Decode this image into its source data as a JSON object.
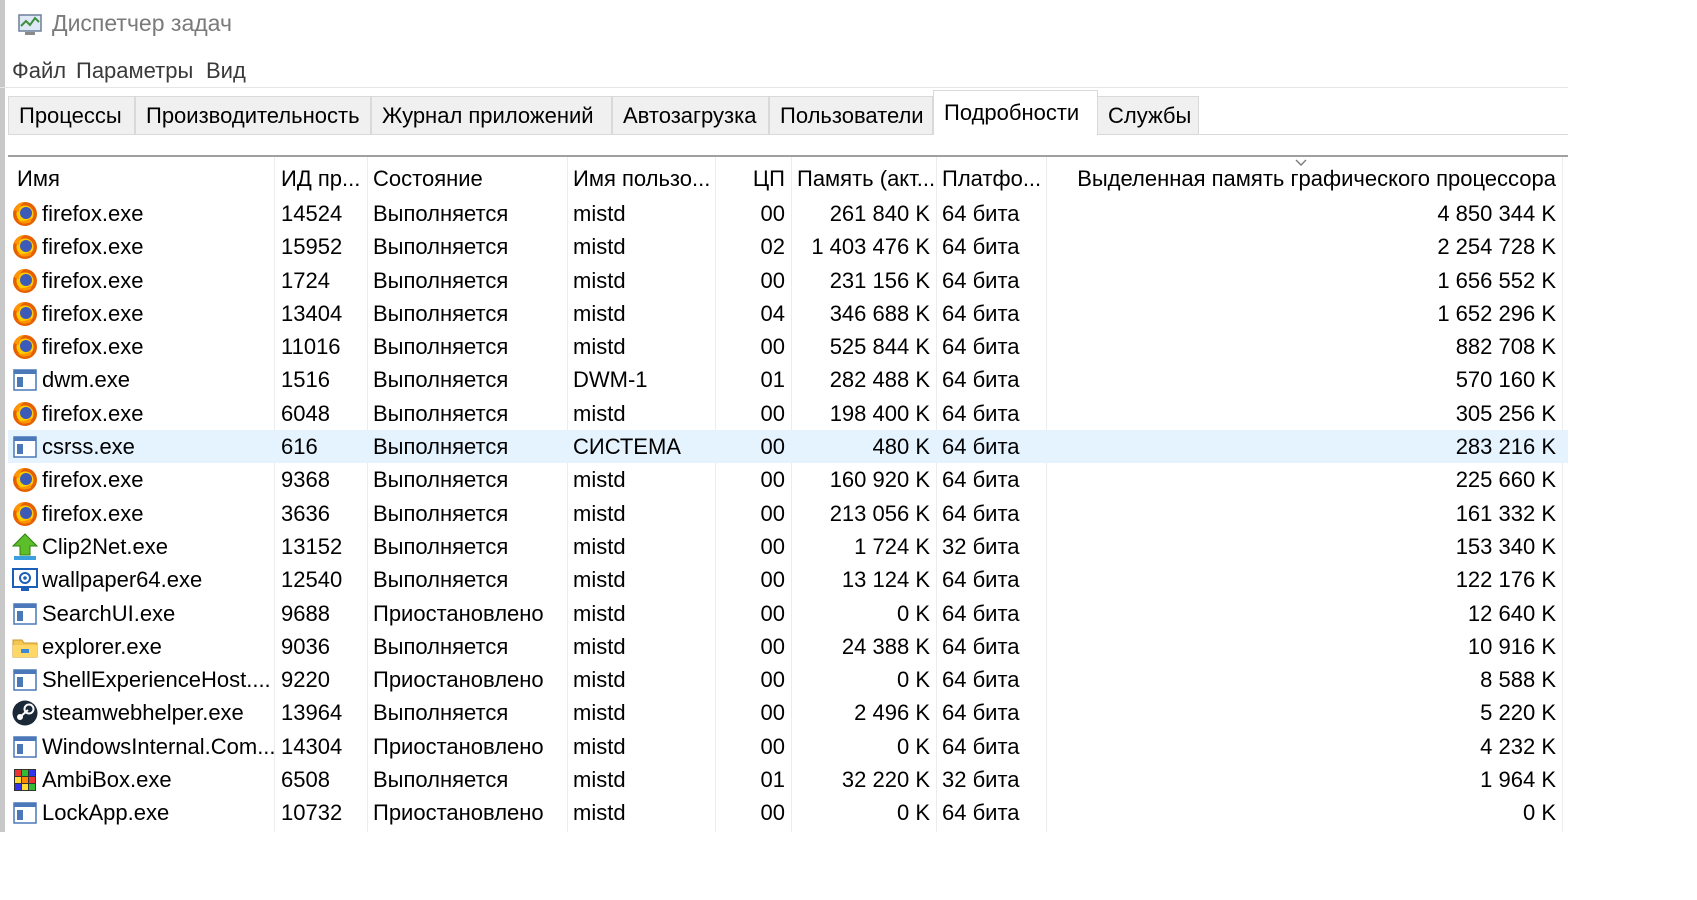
{
  "window": {
    "title": "Диспетчер задач"
  },
  "menu": [
    "Файл",
    "Параметры",
    "Вид"
  ],
  "tabs": [
    {
      "label": "Процессы",
      "active": false
    },
    {
      "label": "Производительность",
      "active": false
    },
    {
      "label": "Журнал приложений",
      "active": false
    },
    {
      "label": "Автозагрузка",
      "active": false
    },
    {
      "label": "Пользователи",
      "active": false
    },
    {
      "label": "Подробности",
      "active": true
    },
    {
      "label": "Службы",
      "active": false
    }
  ],
  "columns": [
    "Имя",
    "ИД пр...",
    "Состояние",
    "Имя пользо...",
    "ЦП",
    "Память (акт...",
    "Платфо...",
    "Выделенная память графического процессора"
  ],
  "rows": [
    {
      "icon": "firefox-icon",
      "name": "firefox.exe",
      "pid": "14524",
      "status": "Выполняется",
      "user": "mistd",
      "cpu": "00",
      "mem": "261 840 K",
      "platform": "64 бита",
      "gpu_mem": "4 850 344 K"
    },
    {
      "icon": "firefox-icon",
      "name": "firefox.exe",
      "pid": "15952",
      "status": "Выполняется",
      "user": "mistd",
      "cpu": "02",
      "mem": "1 403 476 K",
      "platform": "64 бита",
      "gpu_mem": "2 254 728 K"
    },
    {
      "icon": "firefox-icon",
      "name": "firefox.exe",
      "pid": "1724",
      "status": "Выполняется",
      "user": "mistd",
      "cpu": "00",
      "mem": "231 156 K",
      "platform": "64 бита",
      "gpu_mem": "1 656 552 K"
    },
    {
      "icon": "firefox-icon",
      "name": "firefox.exe",
      "pid": "13404",
      "status": "Выполняется",
      "user": "mistd",
      "cpu": "04",
      "mem": "346 688 K",
      "platform": "64 бита",
      "gpu_mem": "1 652 296 K"
    },
    {
      "icon": "firefox-icon",
      "name": "firefox.exe",
      "pid": "11016",
      "status": "Выполняется",
      "user": "mistd",
      "cpu": "00",
      "mem": "525 844 K",
      "platform": "64 бита",
      "gpu_mem": "882 708 K"
    },
    {
      "icon": "window-icon",
      "name": "dwm.exe",
      "pid": "1516",
      "status": "Выполняется",
      "user": "DWM-1",
      "cpu": "01",
      "mem": "282 488 K",
      "platform": "64 бита",
      "gpu_mem": "570 160 K"
    },
    {
      "icon": "firefox-icon",
      "name": "firefox.exe",
      "pid": "6048",
      "status": "Выполняется",
      "user": "mistd",
      "cpu": "00",
      "mem": "198 400 K",
      "platform": "64 бита",
      "gpu_mem": "305 256 K"
    },
    {
      "icon": "window-icon",
      "name": "csrss.exe",
      "pid": "616",
      "status": "Выполняется",
      "user": "СИСТЕМА",
      "cpu": "00",
      "mem": "480 K",
      "platform": "64 бита",
      "gpu_mem": "283 216 K",
      "selected": true
    },
    {
      "icon": "firefox-icon",
      "name": "firefox.exe",
      "pid": "9368",
      "status": "Выполняется",
      "user": "mistd",
      "cpu": "00",
      "mem": "160 920 K",
      "platform": "64 бита",
      "gpu_mem": "225 660 K"
    },
    {
      "icon": "firefox-icon",
      "name": "firefox.exe",
      "pid": "3636",
      "status": "Выполняется",
      "user": "mistd",
      "cpu": "00",
      "mem": "213 056 K",
      "platform": "64 бита",
      "gpu_mem": "161 332 K"
    },
    {
      "icon": "clip2net-icon",
      "name": "Clip2Net.exe",
      "pid": "13152",
      "status": "Выполняется",
      "user": "mistd",
      "cpu": "00",
      "mem": "1 724 K",
      "platform": "32 бита",
      "gpu_mem": "153 340 K"
    },
    {
      "icon": "wallpaper-icon",
      "name": "wallpaper64.exe",
      "pid": "12540",
      "status": "Выполняется",
      "user": "mistd",
      "cpu": "00",
      "mem": "13 124 K",
      "platform": "64 бита",
      "gpu_mem": "122 176 K"
    },
    {
      "icon": "window-icon",
      "name": "SearchUI.exe",
      "pid": "9688",
      "status": "Приостановлено",
      "user": "mistd",
      "cpu": "00",
      "mem": "0 K",
      "platform": "64 бита",
      "gpu_mem": "12 640 K"
    },
    {
      "icon": "folder-icon",
      "name": "explorer.exe",
      "pid": "9036",
      "status": "Выполняется",
      "user": "mistd",
      "cpu": "00",
      "mem": "24 388 K",
      "platform": "64 бита",
      "gpu_mem": "10 916 K"
    },
    {
      "icon": "window-icon",
      "name": "ShellExperienceHost....",
      "pid": "9220",
      "status": "Приостановлено",
      "user": "mistd",
      "cpu": "00",
      "mem": "0 K",
      "platform": "64 бита",
      "gpu_mem": "8 588 K"
    },
    {
      "icon": "steam-icon",
      "name": "steamwebhelper.exe",
      "pid": "13964",
      "status": "Выполняется",
      "user": "mistd",
      "cpu": "00",
      "mem": "2 496 K",
      "platform": "64 бита",
      "gpu_mem": "5 220 K"
    },
    {
      "icon": "window-icon",
      "name": "WindowsInternal.Com...",
      "pid": "14304",
      "status": "Приостановлено",
      "user": "mistd",
      "cpu": "00",
      "mem": "0 K",
      "platform": "64 бита",
      "gpu_mem": "4 232 K"
    },
    {
      "icon": "ambibox-icon",
      "name": "AmbiBox.exe",
      "pid": "6508",
      "status": "Выполняется",
      "user": "mistd",
      "cpu": "01",
      "mem": "32 220 K",
      "platform": "32 бита",
      "gpu_mem": "1 964 K"
    },
    {
      "icon": "window-icon",
      "name": "LockApp.exe",
      "pid": "10732",
      "status": "Приостановлено",
      "user": "mistd",
      "cpu": "00",
      "mem": "0 K",
      "platform": "64 бита",
      "gpu_mem": "0 K"
    }
  ]
}
